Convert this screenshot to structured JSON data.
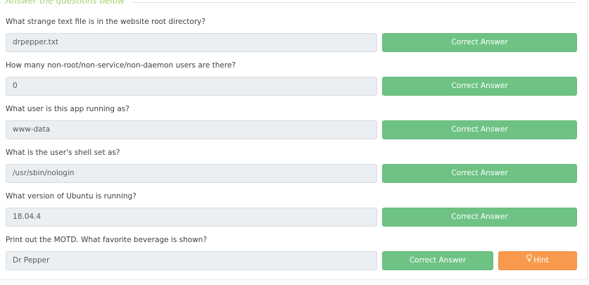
{
  "section": {
    "legend": "Answer the questions below"
  },
  "questions": [
    {
      "question": "What strange text file is in the website root directory?",
      "answer": "drpepper.txt",
      "button_label": "Correct Answer"
    },
    {
      "question": "How many non-root/non-service/non-daemon users are there?",
      "answer": "0",
      "button_label": "Correct Answer"
    },
    {
      "question": "What user is this app running as?",
      "answer": "www-data",
      "button_label": "Correct Answer"
    },
    {
      "question": "What is the user's shell set as?",
      "answer": "/usr/sbin/nologin",
      "button_label": "Correct Answer"
    },
    {
      "question": "What version of Ubuntu is running?",
      "answer": "18.04.4",
      "button_label": "Correct Answer"
    },
    {
      "question": "Print out the MOTD.  What favorite beverage is shown?",
      "answer": "Dr Pepper",
      "button_label": "Correct Answer",
      "hint_label": "Hint",
      "hint_icon": "lightbulb-icon"
    }
  ],
  "colors": {
    "correct_button": "#6ec384",
    "hint_button": "#f79a4e",
    "legend_text": "#9fd26b",
    "answer_field_bg": "#eceff2"
  }
}
